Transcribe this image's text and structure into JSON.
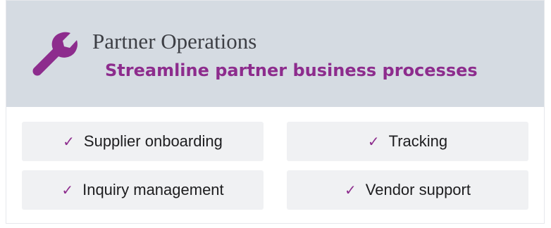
{
  "header": {
    "icon": "wrench-icon",
    "title": "Partner Operations",
    "subtitle": "Streamline partner business processes"
  },
  "features": [
    {
      "icon": "check-icon",
      "check_glyph": "✓",
      "label": "Supplier onboarding"
    },
    {
      "icon": "check-icon",
      "check_glyph": "✓",
      "label": "Tracking"
    },
    {
      "icon": "check-icon",
      "check_glyph": "✓",
      "label": "Inquiry management"
    },
    {
      "icon": "check-icon",
      "check_glyph": "✓",
      "label": "Vendor support"
    }
  ],
  "colors": {
    "accent": "#8d2c8d",
    "header_background": "#d5dbe2",
    "tag_background": "#f0f1f3",
    "title_text": "#3d3f45",
    "tag_text": "#1d1d1f"
  }
}
